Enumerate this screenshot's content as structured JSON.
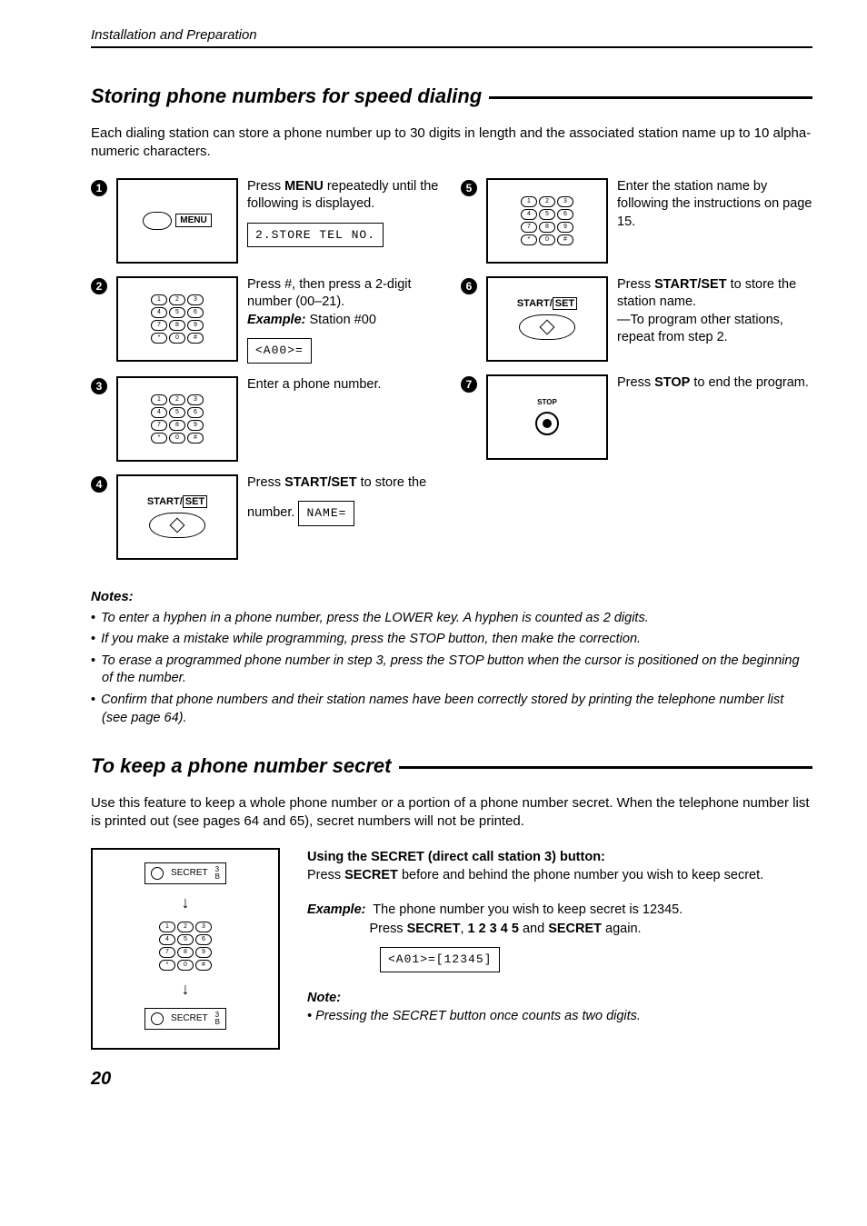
{
  "header": "Installation and Preparation",
  "section1": {
    "title": "Storing phone numbers for speed dialing",
    "intro": "Each dialing station can store a phone number up to 30 digits in length and the associated station name up to 10 alpha-numeric characters.",
    "steps": {
      "s1": {
        "text_a": "Press ",
        "bold1": "MENU",
        "text_b": " repeatedly until the following is displayed.",
        "lcd": "2.STORE TEL NO."
      },
      "s2": {
        "text_a": "Press #, then press a 2-digit number (00–21).",
        "example_lbl": "Example:",
        "example_val": " Station #00",
        "lcd": "<A00>="
      },
      "s3": {
        "text": "Enter a phone number."
      },
      "s4": {
        "text_a": "Press ",
        "bold1": "START/SET",
        "text_b": " to store the number.",
        "lcd": "NAME="
      },
      "s5": {
        "text": "Enter the station name by following the instructions on page 15."
      },
      "s6": {
        "text_a": "Press ",
        "bold1": "START/SET",
        "text_b": " to store the station name.",
        "sub": "—To program other stations, repeat from step 2."
      },
      "s7": {
        "text_a": "Press ",
        "bold1": "STOP",
        "text_b": " to end the program."
      }
    },
    "panel": {
      "menu": "MENU",
      "start": "START/",
      "set": "SET",
      "stop": "STOP"
    },
    "notes_hdr": "Notes:",
    "notes": [
      "To enter a hyphen in a phone number, press the LOWER key. A hyphen is counted as 2 digits.",
      "If you make a mistake while programming, press the STOP button, then make the correction.",
      "To erase a programmed phone number in step 3, press the STOP button when the cursor is positioned on the beginning of the number.",
      "Confirm that phone numbers and their station names have been correctly stored by printing the telephone number list (see page 64)."
    ]
  },
  "section2": {
    "title": "To keep a phone number secret",
    "intro": "Use this feature to keep a whole phone number or a portion of a phone number secret. When the telephone number list is printed out (see pages 64 and 65), secret numbers will not be printed.",
    "panel": {
      "secret": "SECRET",
      "sup": "3",
      "sub": "B"
    },
    "using_hdr": "Using the SECRET (direct call station 3) button:",
    "using_a": "Press ",
    "using_bold": "SECRET",
    "using_b": " before and behind the phone number you wish to keep secret.",
    "example_lbl": "Example:",
    "example_line1": "The phone number you wish to keep secret is 12345.",
    "example_line2a": "Press ",
    "example_line2b": "SECRET",
    "example_line2c": ", ",
    "example_line2d": "1 2 3 4 5",
    "example_line2e": " and ",
    "example_line2f": "SECRET",
    "example_line2g": " again.",
    "lcd": "<A01>=[12345]",
    "note_hdr": "Note:",
    "note": "Pressing the SECRET button once counts as two digits."
  },
  "pagenum": "20"
}
